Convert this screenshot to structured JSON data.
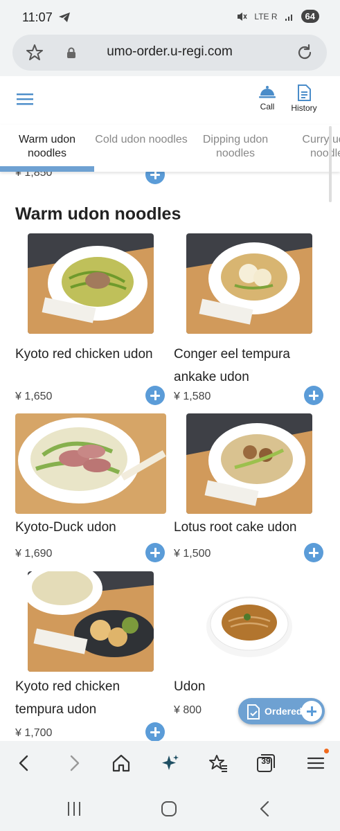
{
  "status_bar": {
    "time": "11:07",
    "network": "LTE R",
    "battery": "64"
  },
  "browser": {
    "url": "umo-order.u-regi.com",
    "tabs_count": "39"
  },
  "header": {
    "call_label": "Call",
    "history_label": "History"
  },
  "tabs": [
    {
      "label": "Warm udon noodles",
      "active": true
    },
    {
      "label": "Cold udon noodles",
      "active": false
    },
    {
      "label": "Dipping udon noodles",
      "active": false
    },
    {
      "label": "Curry udon noodles",
      "active": false
    }
  ],
  "previous_price": "¥ 1,850",
  "section_title": "Warm udon noodles",
  "items": [
    {
      "name": "Kyoto red chicken udon",
      "price": "¥ 1,650"
    },
    {
      "name": "Conger eel tempura ankake udon",
      "price": "¥ 1,580"
    },
    {
      "name": "Kyoto-Duck udon",
      "price": "¥ 1,690"
    },
    {
      "name": "Lotus root cake udon",
      "price": "¥ 1,500"
    },
    {
      "name": "Kyoto red chicken tempura udon",
      "price": "¥ 1,700"
    },
    {
      "name": "Udon",
      "price": "¥ 800"
    }
  ],
  "ordered_label": "Ordered",
  "colors": {
    "accent": "#5b9cd8",
    "tab_underline": "#6ea1d2",
    "notification_dot": "#f06a1d"
  }
}
